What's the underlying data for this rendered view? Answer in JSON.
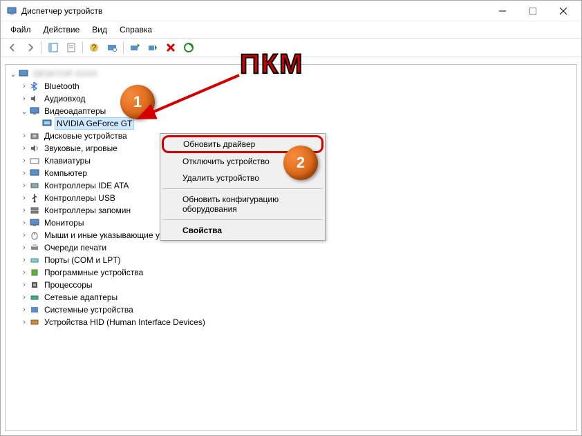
{
  "window": {
    "title": "Диспетчер устройств"
  },
  "menu": {
    "file": "Файл",
    "action": "Действие",
    "view": "Вид",
    "help": "Справка"
  },
  "tree": {
    "root": "",
    "items": [
      {
        "label": "Bluetooth",
        "icon": "bluetooth"
      },
      {
        "label": "Аудиовходы и аудиовыходы",
        "icon": "audio",
        "truncated": "Аудиовход"
      },
      {
        "label": "Видеоадаптеры",
        "icon": "display",
        "expanded": true,
        "children": [
          {
            "label": "NVIDIA GeForce GT",
            "icon": "display-card",
            "selected": true
          }
        ]
      },
      {
        "label": "Дисковые устройства",
        "icon": "disk"
      },
      {
        "label": "Звуковые, игровые и видеоустройства",
        "icon": "sound",
        "truncated": "Звуковые, игровые"
      },
      {
        "label": "Клавиатуры",
        "icon": "keyboard"
      },
      {
        "label": "Компьютер",
        "icon": "computer"
      },
      {
        "label": "Контроллеры IDE ATA/ATAPI",
        "icon": "ide",
        "truncated": "Контроллеры IDE ATA"
      },
      {
        "label": "Контроллеры USB",
        "icon": "usb"
      },
      {
        "label": "Контроллеры запоминающих устройств",
        "icon": "storage",
        "truncated": "Контроллеры запомин"
      },
      {
        "label": "Мониторы",
        "icon": "monitor"
      },
      {
        "label": "Мыши и иные указывающие устройства",
        "icon": "mouse"
      },
      {
        "label": "Очереди печати",
        "icon": "printer"
      },
      {
        "label": "Порты (COM и LPT)",
        "icon": "port"
      },
      {
        "label": "Программные устройства",
        "icon": "software"
      },
      {
        "label": "Процессоры",
        "icon": "cpu"
      },
      {
        "label": "Сетевые адаптеры",
        "icon": "network"
      },
      {
        "label": "Системные устройства",
        "icon": "system"
      },
      {
        "label": "Устройства HID (Human Interface Devices)",
        "icon": "hid"
      }
    ]
  },
  "context_menu": {
    "update": "Обновить драйвер",
    "disable": "Отключить устройство",
    "remove": "Удалить устройство",
    "rescan": "Обновить конфигурацию оборудования",
    "props": "Свойства"
  },
  "annotations": {
    "rmb": "ПКМ",
    "step1": "1",
    "step2": "2"
  }
}
